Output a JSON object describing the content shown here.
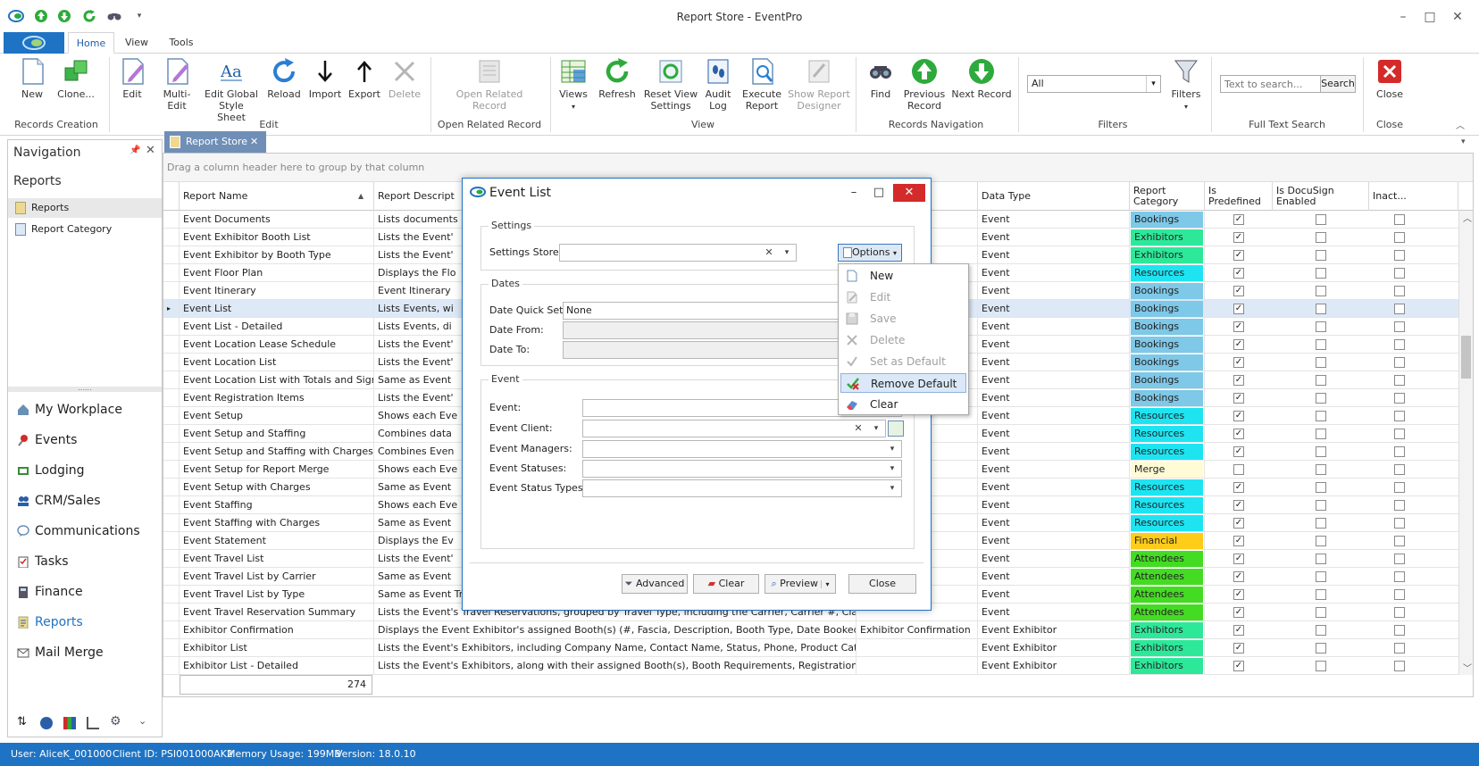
{
  "window": {
    "title": "Report Store - EventPro",
    "controls": {
      "minimize": "–",
      "maximize": "□",
      "close": "✕"
    }
  },
  "ribbon": {
    "tabs": [
      "Home",
      "View",
      "Tools"
    ],
    "active_tab": "Home",
    "buttons": {
      "new": "New",
      "clone": "Clone...",
      "edit": "Edit",
      "multi_edit": "Multi-Edit",
      "edit_global_style_1": "Edit Global",
      "edit_global_style_2": "Style Sheet",
      "reload": "Reload",
      "import": "Import",
      "export": "Export",
      "delete": "Delete",
      "open_related_1": "Open Related",
      "open_related_2": "Record",
      "views": "Views",
      "refresh": "Refresh",
      "reset_view_1": "Reset View",
      "reset_view_2": "Settings",
      "audit_1": "Audit",
      "audit_2": "Log",
      "execute_1": "Execute",
      "execute_2": "Report",
      "show_designer_1": "Show Report",
      "show_designer_2": "Designer",
      "find": "Find",
      "previous_1": "Previous",
      "previous_2": "Record",
      "next_record": "Next Record",
      "filters": "Filters",
      "close": "Close"
    },
    "filter_select": "All",
    "search_placeholder": "Text to search...",
    "search_button": "Search",
    "groups": {
      "records_creation": "Records Creation",
      "edit": "Edit",
      "open_related": "Open Related Record",
      "view": "View",
      "records_navigation": "Records Navigation",
      "filters": "Filters",
      "full_text_search": "Full Text Search",
      "close": "Close"
    }
  },
  "navigation": {
    "title": "Navigation",
    "section": "Reports",
    "items": [
      "Reports",
      "Report Category"
    ],
    "modules": [
      "My Workplace",
      "Events",
      "Lodging",
      "CRM/Sales",
      "Communications",
      "Tasks",
      "Finance",
      "Reports",
      "Mail Merge"
    ],
    "grip": "......"
  },
  "document": {
    "tab_label": "Report Store",
    "group_hint": "Drag a column header here to group by that column",
    "columns": {
      "report_name": "Report Name",
      "report_description": "Report Descript",
      "location_type_1": "ocation",
      "location_type_2": "e",
      "data_type": "Data Type",
      "report_category_1": "Report",
      "report_category_2": "Category",
      "is_predefined_1": "Is",
      "is_predefined_2": "Predefined",
      "is_docusign_1": "Is DocuSign",
      "is_docusign_2": "Enabled",
      "inactive": "Inact..."
    },
    "rows": [
      {
        "name": "Event Documents",
        "desc": "Lists documents",
        "loc": "",
        "type": "Event",
        "cat": "Bookings",
        "pre": true
      },
      {
        "name": "Event Exhibitor Booth List",
        "desc": "Lists the Event'",
        "loc": "",
        "type": "Event",
        "cat": "Exhibitors",
        "pre": true
      },
      {
        "name": "Event Exhibitor by Booth Type",
        "desc": "Lists the Event'",
        "loc": "",
        "type": "Event",
        "cat": "Exhibitors",
        "pre": true
      },
      {
        "name": "Event Floor Plan",
        "desc": "Displays the Flo",
        "loc": "",
        "type": "Event",
        "cat": "Resources",
        "pre": true
      },
      {
        "name": "Event Itinerary",
        "desc": "Event Itinerary",
        "loc": "",
        "type": "Event",
        "cat": "Bookings",
        "pre": true
      },
      {
        "name": "Event List",
        "desc": "Lists Events, wi",
        "loc": "",
        "type": "Event",
        "cat": "Bookings",
        "pre": true
      },
      {
        "name": "Event List - Detailed",
        "desc": "Lists Events, di",
        "loc": "",
        "type": "Event",
        "cat": "Bookings",
        "pre": true
      },
      {
        "name": "Event Location Lease Schedule",
        "desc": "Lists the Event'",
        "loc": "ation",
        "type": "Event",
        "cat": "Bookings",
        "pre": true
      },
      {
        "name": "Event Location List",
        "desc": "Lists the Event'",
        "loc": "ation",
        "type": "Event",
        "cat": "Bookings",
        "pre": true
      },
      {
        "name": "Event Location List with Totals and Sign Off",
        "desc": "Same as Event",
        "loc": "ation",
        "type": "Event",
        "cat": "Bookings",
        "pre": true
      },
      {
        "name": "Event Registration Items",
        "desc": "Lists the Event'",
        "loc": "",
        "type": "Event",
        "cat": "Bookings",
        "pre": true
      },
      {
        "name": "Event Setup",
        "desc": "Shows each Eve",
        "loc": "",
        "type": "Event",
        "cat": "Resources",
        "pre": true
      },
      {
        "name": "Event Setup and Staffing",
        "desc": "Combines data",
        "loc": "",
        "type": "Event",
        "cat": "Resources",
        "pre": true
      },
      {
        "name": "Event Setup and Staffing with Charges",
        "desc": "Combines Even",
        "loc": "",
        "type": "Event",
        "cat": "Resources",
        "pre": true
      },
      {
        "name": "Event Setup for Report Merge",
        "desc": "Shows each Eve",
        "loc": "",
        "type": "Event",
        "cat": "Merge",
        "pre": false
      },
      {
        "name": "Event Setup with Charges",
        "desc": "Same as Event",
        "loc": "",
        "type": "Event",
        "cat": "Resources",
        "pre": true
      },
      {
        "name": "Event Staffing",
        "desc": "Shows each Eve",
        "loc": "",
        "type": "Event",
        "cat": "Resources",
        "pre": true
      },
      {
        "name": "Event Staffing with Charges",
        "desc": "Same as Event",
        "loc": "",
        "type": "Event",
        "cat": "Resources",
        "pre": true
      },
      {
        "name": "Event Statement",
        "desc": "Displays the Ev",
        "loc": "",
        "type": "Event",
        "cat": "Financial",
        "pre": true
      },
      {
        "name": "Event Travel List",
        "desc": "Lists the Event'",
        "loc": "",
        "type": "Event",
        "cat": "Attendees",
        "pre": true
      },
      {
        "name": "Event Travel List by Carrier",
        "desc": "Same as Event",
        "loc": "",
        "type": "Event",
        "cat": "Attendees",
        "pre": true
      },
      {
        "name": "Event Travel List by Type",
        "desc": "Same as Event Travel List, except Travel Bookings are grouped by Travel Type/Travel Class.",
        "loc": "",
        "type": "Event",
        "cat": "Attendees",
        "pre": true
      },
      {
        "name": "Event Travel Reservation Summary",
        "desc": "Lists the Event's Travel Reservations, grouped by Travel Type, including the Carrier, Carrier #, Class, Departin...",
        "loc": "",
        "type": "Event",
        "cat": "Attendees",
        "pre": true
      },
      {
        "name": "Exhibitor Confirmation",
        "desc": "Displays the Event Exhibitor's assigned Booth(s) (#, Fascia, Description, Booth Type, Date Booked, Booked Fro...",
        "loc": "Exhibitor Confirmation",
        "type": "Event Exhibitor",
        "cat": "Exhibitors",
        "pre": true
      },
      {
        "name": "Exhibitor List",
        "desc": "Lists the Event's Exhibitors, including Company Name, Contact Name, Status, Phone, Product Category 1 & 2, ...",
        "loc": "",
        "type": "Event Exhibitor",
        "cat": "Exhibitors",
        "pre": true
      },
      {
        "name": "Exhibitor List - Detailed",
        "desc": "Lists the Event's Exhibitors, along with their assigned Booth(s), Booth Requirements, Registration Items, Exhibit...",
        "loc": "",
        "type": "Event Exhibitor",
        "cat": "Exhibitors",
        "pre": true
      }
    ],
    "selected_row": "Event List",
    "record_count": "274"
  },
  "category_colors": {
    "Bookings": "#7ec8e8",
    "Exhibitors": "#2ee89a",
    "Resources": "#1ee4f2",
    "Merge": "#fffbd6",
    "Financial": "#ffcc1a",
    "Attendees": "#44dc22"
  },
  "dialog": {
    "title": "Event List",
    "settings_legend": "Settings",
    "settings_store_label": "Settings Store:",
    "settings_store_value": "",
    "options_button": "Options",
    "dates_legend": "Dates",
    "date_quick_set_label": "Date Quick Set:",
    "date_quick_set_value": "None",
    "date_from_label": "Date From:",
    "date_to_label": "Date To:",
    "event_legend": "Event",
    "event_label": "Event:",
    "event_client_label": "Event Client:",
    "event_managers_label": "Event Managers:",
    "event_statuses_label": "Event Statuses:",
    "event_status_types_label": "Event Status Types:",
    "buttons": {
      "advanced": "Advanced",
      "clear": "Clear",
      "preview": "Preview",
      "close": "Close"
    }
  },
  "options_menu": {
    "items": [
      {
        "label": "New",
        "enabled": true
      },
      {
        "label": "Edit",
        "enabled": false
      },
      {
        "label": "Save",
        "enabled": false
      },
      {
        "label": "Delete",
        "enabled": false
      },
      {
        "label": "Set as Default",
        "enabled": false
      },
      {
        "label": "Remove Default",
        "enabled": true,
        "highlighted": true
      },
      {
        "label": "Clear",
        "enabled": true
      }
    ]
  },
  "status_bar": {
    "user": "User: AliceK_001000",
    "client_id": "Client ID: PSI001000AK2",
    "memory": "Memory Usage: 199MB",
    "version": "Version: 18.0.10"
  }
}
